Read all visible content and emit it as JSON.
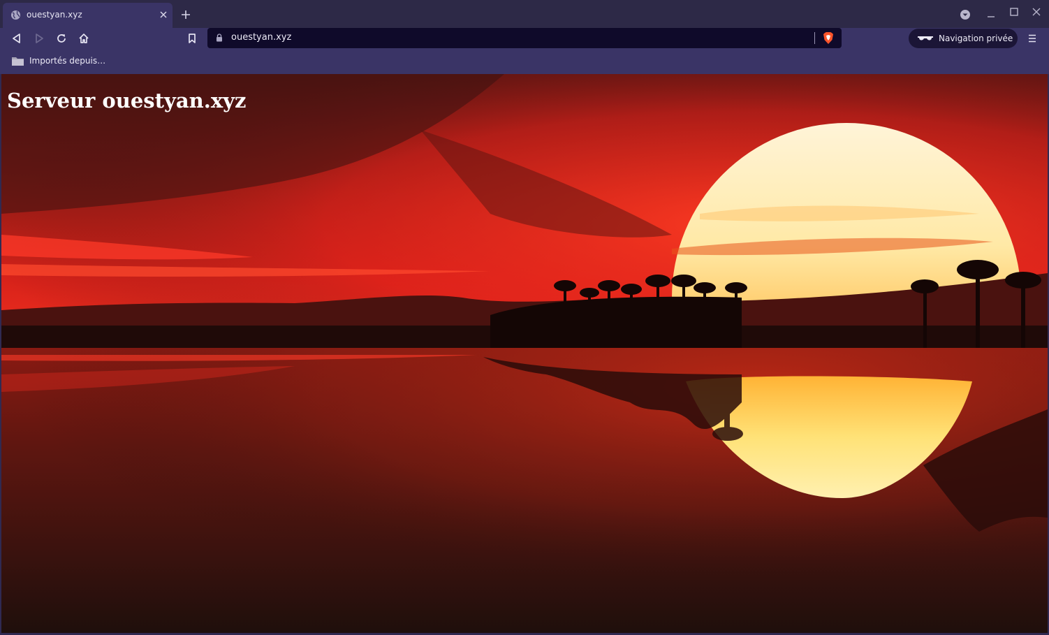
{
  "browser": {
    "tab": {
      "title": "ouestyan.xyz",
      "icon": "globe-icon"
    },
    "address": {
      "url": "ouestyan.xyz",
      "icon": "lock-icon"
    },
    "private_mode": {
      "label": "Navigation privée",
      "icon": "private-glasses-icon"
    },
    "bookmarks": [
      {
        "label": "Importés depuis…",
        "icon": "folder-icon"
      }
    ],
    "colors": {
      "tabstrip": "#2d2947",
      "toolbar": "#3a3466",
      "urlbar": "#0f0a2a",
      "brave_accent": "#fb542b"
    }
  },
  "page": {
    "heading": "Serveur ouestyan.xyz",
    "background": "sunset-lake-palm-trees-image"
  }
}
